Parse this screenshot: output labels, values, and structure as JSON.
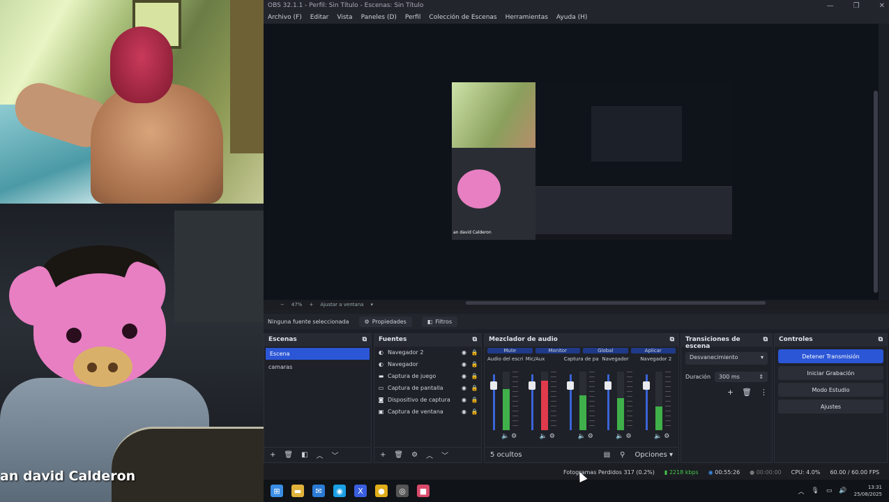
{
  "camera": {
    "name": "an david Calderon"
  },
  "window": {
    "title": "OBS 32.1.1 - Perfil: Sin Título - Escenas: Sin Título",
    "controls": [
      "—",
      "❐",
      "✕"
    ]
  },
  "menu": [
    "Archivo (F)",
    "Editar",
    "Vista",
    "Paneles (D)",
    "Perfil",
    "Colección de Escenas",
    "Herramientas",
    "Ayuda (H)"
  ],
  "preview": {
    "zoom": "47%",
    "mode": "Ajustar a ventana",
    "canvas_label": "an david Calderon"
  },
  "source_bar": {
    "status": "Ninguna fuente seleccionada",
    "properties": "Propiedades",
    "filters": "Filtros"
  },
  "scenes": {
    "title": "Escenas",
    "items": [
      "Escena",
      "camaras"
    ],
    "selected": 0
  },
  "sources": {
    "title": "Fuentes",
    "items": [
      {
        "icon": "◐",
        "name": "Navegador 2"
      },
      {
        "icon": "◐",
        "name": "Navegador"
      },
      {
        "icon": "▬",
        "name": "Captura de juego"
      },
      {
        "icon": "▭",
        "name": "Captura de pantalla"
      },
      {
        "icon": "◙",
        "name": "Dispositivo de captura"
      },
      {
        "icon": "▣",
        "name": "Captura de ventana"
      }
    ]
  },
  "mixer": {
    "title": "Mezclador de audio",
    "headers": [
      "Mute",
      "Monitor",
      "Global",
      "Aplicar"
    ],
    "channels": [
      {
        "name": "Audio del escritorio",
        "level": 0.7,
        "color": "#3fb04a"
      },
      {
        "name": "Mic/Aux",
        "level": 0.85,
        "color": "#e03a4c"
      },
      {
        "name": "Captura de pantalla",
        "level": 0.6,
        "color": "#3fb04a"
      },
      {
        "name": "Navegador",
        "level": 0.55,
        "color": "#3fb04a"
      },
      {
        "name": "Navegador 2",
        "level": 0.4,
        "color": "#3fb04a"
      }
    ],
    "footer_left": "5 ocultos",
    "options": "Opciones"
  },
  "transitions": {
    "title": "Transiciones de escena",
    "type": "Desvanecimiento",
    "duration_label": "Duración",
    "duration": "300 ms"
  },
  "controls": {
    "title": "Controles",
    "buttons": [
      "Detener Transmisión",
      "Iniciar Grabación",
      "Modo Estudio",
      "Ajustes"
    ]
  },
  "status": {
    "dropped": "Fotogramas Perdidos 317 (0.2%)",
    "bitrate": "2218 kbps",
    "stream_time": "00:55:26",
    "rec_time": "00:00:00",
    "cpu": "CPU: 4.0%",
    "fps": "60.00 / 60.00 FPS"
  },
  "taskbar": {
    "time": "13:31",
    "date": "25/08/2025",
    "icons": [
      {
        "glyph": "⊞",
        "color": "#3a8ee6"
      },
      {
        "glyph": "▬",
        "color": "#e0b23c"
      },
      {
        "glyph": "✉",
        "color": "#2b7bd6"
      },
      {
        "glyph": "◉",
        "color": "#1aa0e6"
      },
      {
        "glyph": "X",
        "color": "#3a5ee0"
      },
      {
        "glyph": "●",
        "color": "#e0ad1a"
      },
      {
        "glyph": "◎",
        "color": "#555"
      },
      {
        "glyph": "■",
        "color": "#d94a6a"
      }
    ]
  }
}
